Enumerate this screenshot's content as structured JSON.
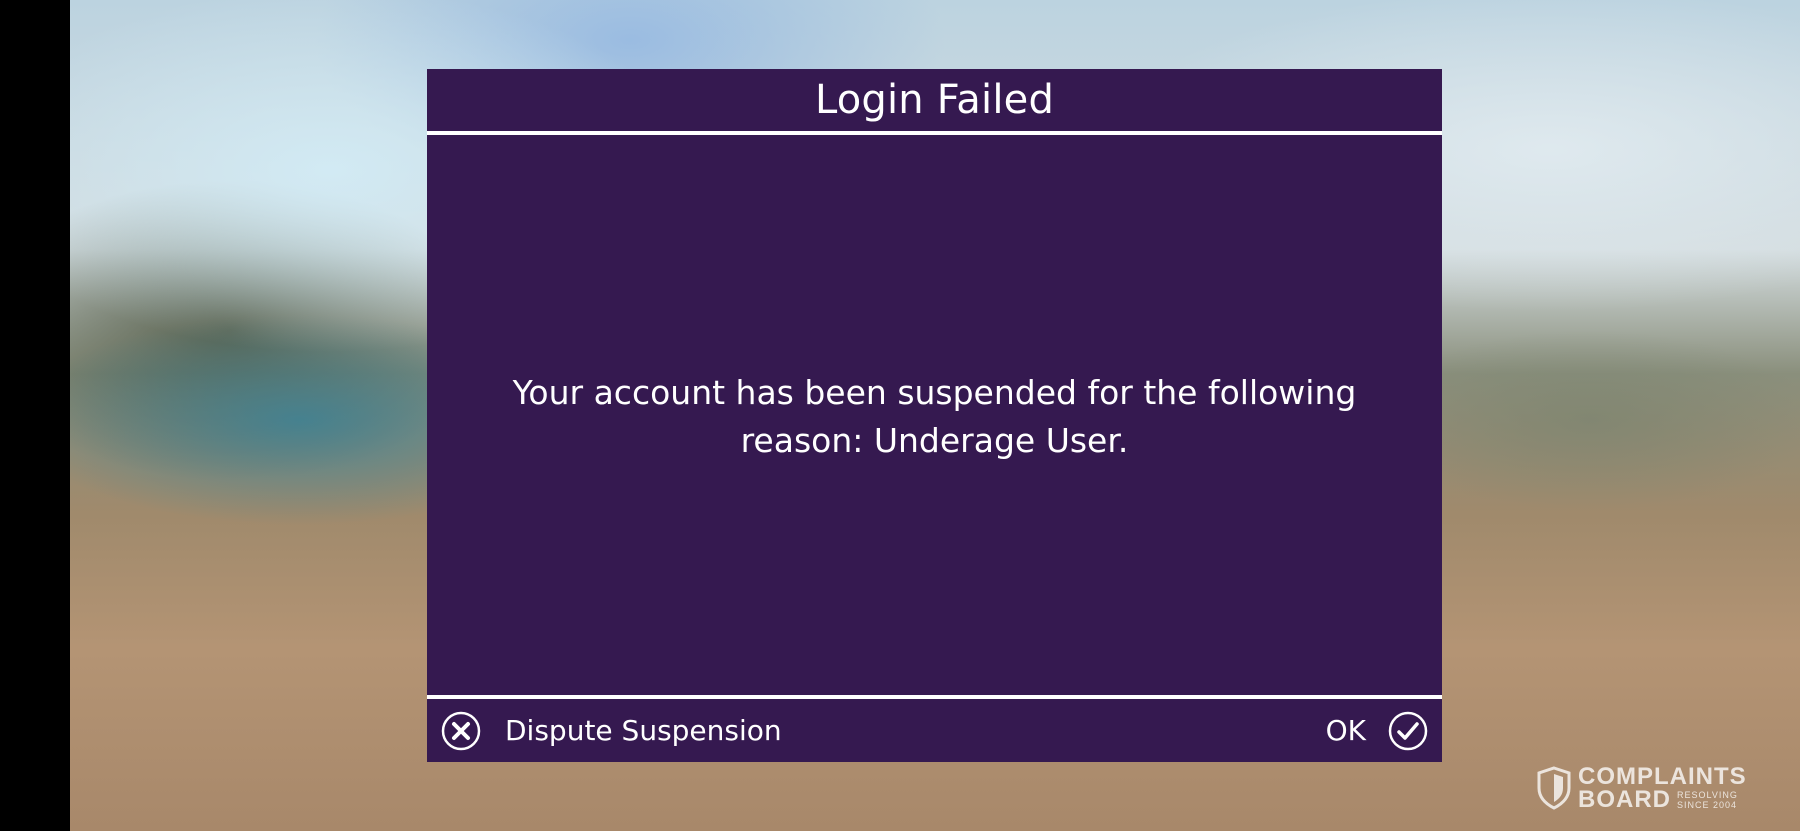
{
  "dialog": {
    "title": "Login Failed",
    "message": "Your account has been suspended for the following reason: Underage User.",
    "background_color": "#351950"
  },
  "footer": {
    "dispute_label": "Dispute Suspension",
    "dispute_icon": "close-circle-icon",
    "ok_label": "OK",
    "ok_icon": "checkmark-circle-icon"
  },
  "watermark": {
    "line1": "COMPLAINTS",
    "line2": "BOARD",
    "tag1": "RESOLVING",
    "tag2": "SINCE 2004",
    "icon": "shield-icon"
  }
}
